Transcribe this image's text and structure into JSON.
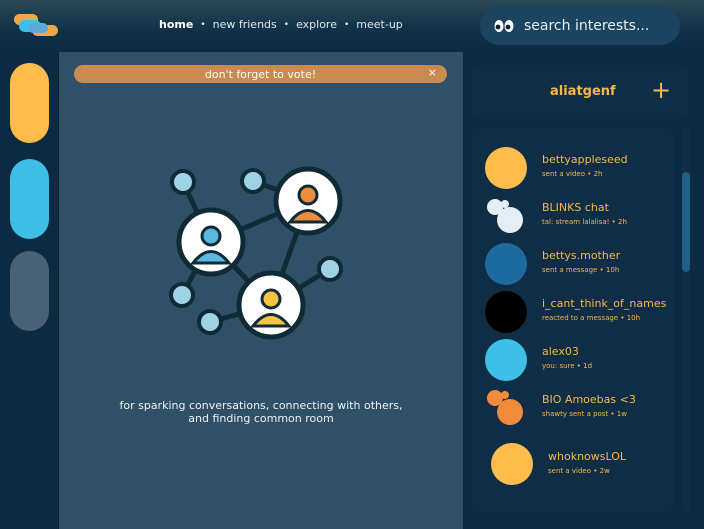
{
  "nav": {
    "items": [
      "home",
      "new friends",
      "explore",
      "meet-up"
    ],
    "active": "home",
    "separator": "•"
  },
  "search": {
    "placeholder": "search interests...",
    "icon": "eyes-icon"
  },
  "sidebar": {
    "pills": [
      {
        "color": "#fdbc4c"
      },
      {
        "color": "#3ebfe8"
      },
      {
        "color": "#4a6174"
      }
    ]
  },
  "banner": {
    "text": "don't forget to vote!",
    "close": "×"
  },
  "main": {
    "tagline_line1": "for sparking conversations, connecting with others,",
    "tagline_line2": "and finding common room"
  },
  "user": {
    "name": "aliatgenf",
    "add": "+"
  },
  "chats": [
    {
      "name": "bettyappleseed",
      "sub": "sent a video • 2h",
      "color": "#fdbc4c"
    },
    {
      "name": "BLINKS chat",
      "sub": "tal: stream lalalisa! • 2h",
      "color": "#e6eef5"
    },
    {
      "name": "bettys.mother",
      "sub": "sent a message • 10h",
      "color": "#1d6a9e"
    },
    {
      "name": "i_cant_think_of_names",
      "sub": "reacted to a message • 10h",
      "color": "#000000"
    },
    {
      "name": "alex03",
      "sub": "you: sure • 1d",
      "color": "#3ebfe8"
    },
    {
      "name": "BIO Amoebas <3",
      "sub": "shawty sent a post • 1w",
      "color": "#f28b3c"
    },
    {
      "name": "whoknowsLOL",
      "sub": "sent a video • 2w",
      "color": "#fdbc4c"
    }
  ]
}
